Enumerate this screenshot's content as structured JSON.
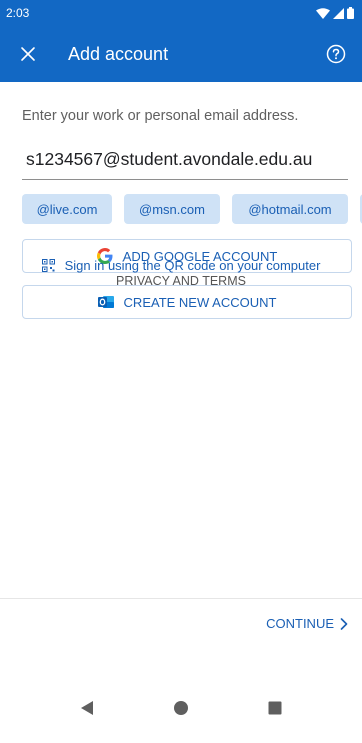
{
  "status_bar": {
    "time": "2:03"
  },
  "app_bar": {
    "title": "Add account"
  },
  "form": {
    "prompt": "Enter your work or personal email address.",
    "email_value": "s1234567@student.avondale.edu.au",
    "domain_chips": [
      "@live.com",
      "@msn.com",
      "@hotmail.com",
      ""
    ]
  },
  "actions": {
    "google_label": "ADD GOOGLE ACCOUNT",
    "create_label": "CREATE NEW ACCOUNT",
    "qr_label": "Sign in using the QR code on your computer",
    "privacy_label": "PRIVACY AND TERMS",
    "continue_label": "CONTINUE"
  },
  "colors": {
    "brand_blue": "#1268c4",
    "link_blue": "#1a5fb4",
    "chip_bg": "#cfe2f6"
  },
  "icons": {
    "close": "close-icon",
    "help": "help-circle-icon",
    "google": "google-g-icon",
    "outlook": "outlook-icon",
    "qr": "qr-code-icon",
    "continue": "chevron-right-icon"
  }
}
